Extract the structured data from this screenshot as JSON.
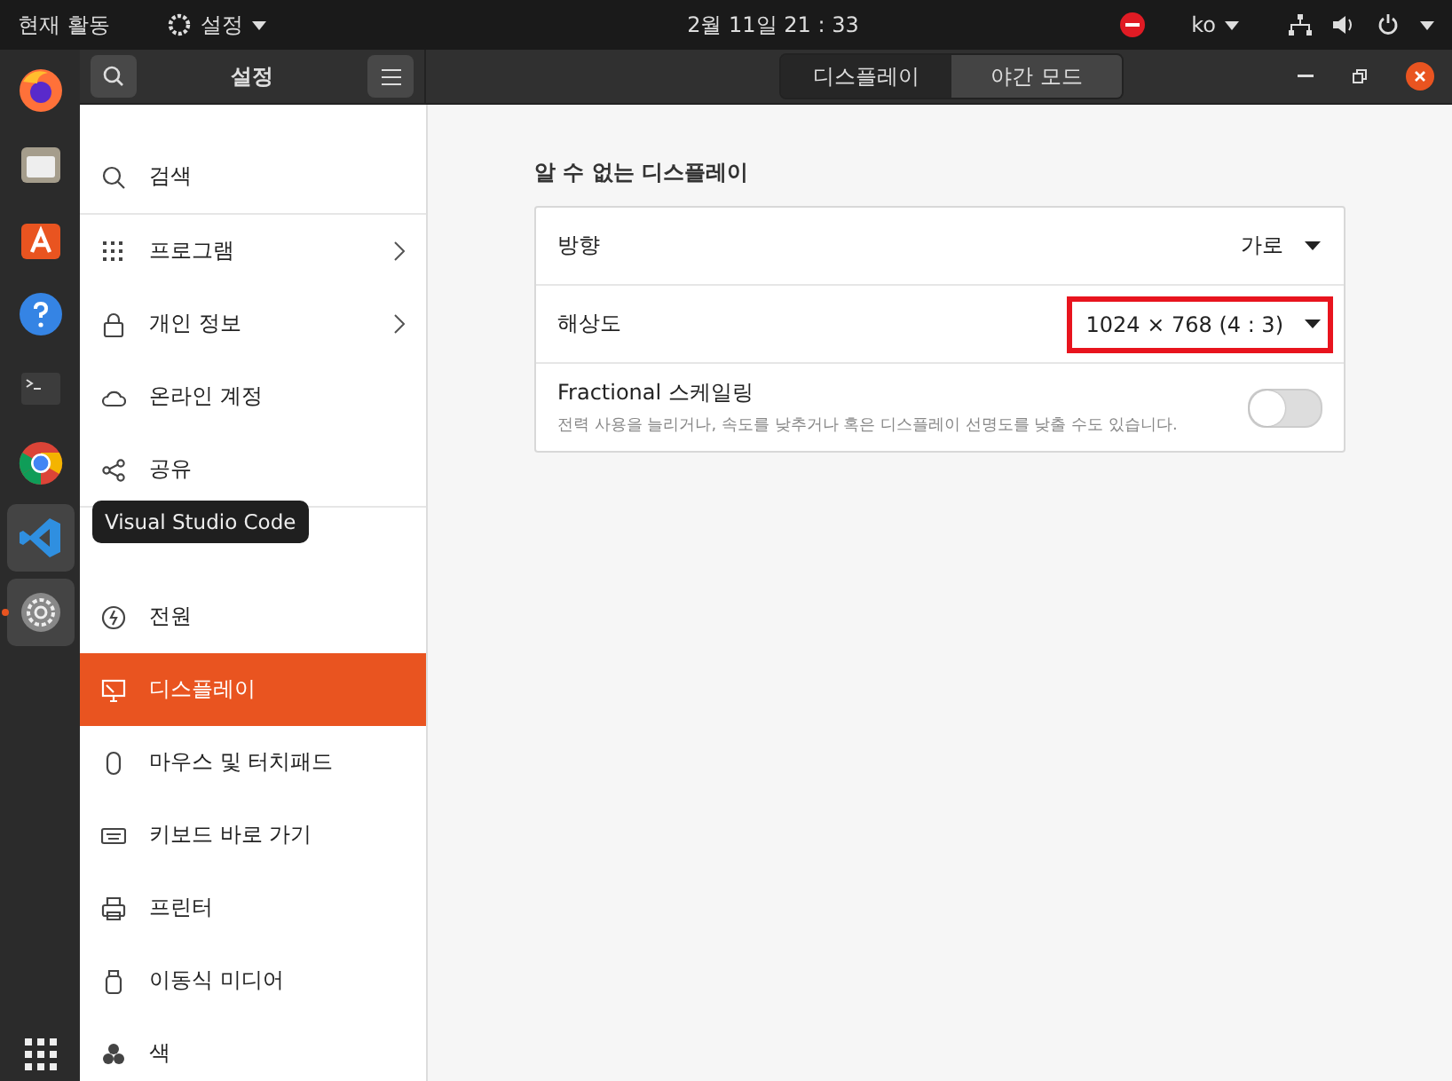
{
  "top_bar": {
    "activities": "현재 활동",
    "app_menu": "설정",
    "clock": "2월 11일  21 : 33",
    "language": "ko"
  },
  "dock": [
    {
      "kind": "firefox",
      "highlighted": false
    },
    {
      "kind": "files",
      "highlighted": false
    },
    {
      "kind": "store",
      "highlighted": false
    },
    {
      "kind": "help",
      "highlighted": false
    },
    {
      "kind": "terminal",
      "highlighted": false
    },
    {
      "kind": "chrome",
      "highlighted": false
    },
    {
      "kind": "vscode",
      "highlighted": true
    },
    {
      "kind": "settings",
      "highlighted": true,
      "running": true
    }
  ],
  "tooltip": "Visual Studio Code",
  "header": {
    "title": "설정",
    "tabs": [
      {
        "label": "디스플레이",
        "selected": true
      },
      {
        "label": "야간 모드",
        "selected": false
      }
    ]
  },
  "sidebar": {
    "items": [
      {
        "kind": "search",
        "label": "검색",
        "selected": false,
        "arrow": false,
        "divider": true
      },
      {
        "kind": "apps",
        "label": "프로그램",
        "selected": false,
        "arrow": true,
        "divider": false
      },
      {
        "kind": "lock",
        "label": "개인 정보",
        "selected": false,
        "arrow": true,
        "divider": false
      },
      {
        "kind": "cloud",
        "label": "온라인 계정",
        "selected": false,
        "arrow": false,
        "divider": false
      },
      {
        "kind": "share",
        "label": "공유",
        "selected": false,
        "arrow": false,
        "divider": true
      },
      {
        "selected": false,
        "arrow": false,
        "divider": false
      },
      {
        "kind": "power",
        "label": "전원",
        "selected": false,
        "arrow": false,
        "divider": false
      },
      {
        "kind": "display",
        "label": "디스플레이",
        "selected": true,
        "arrow": false,
        "divider": false
      },
      {
        "kind": "mouse",
        "label": "마우스 및 터치패드",
        "selected": false,
        "arrow": false,
        "divider": false
      },
      {
        "kind": "keyboard",
        "label": "키보드 바로 가기",
        "selected": false,
        "arrow": false,
        "divider": false
      },
      {
        "kind": "printer",
        "label": "프린터",
        "selected": false,
        "arrow": false,
        "divider": false
      },
      {
        "kind": "usb",
        "label": "이동식 미디어",
        "selected": false,
        "arrow": false,
        "divider": false
      },
      {
        "kind": "color",
        "label": "색",
        "selected": false,
        "arrow": false,
        "divider": false
      }
    ]
  },
  "content": {
    "section_title": "알 수 없는 디스플레이",
    "rows": [
      {
        "kind": "dropdown",
        "label": "방향",
        "value": "가로",
        "highlighted": false
      },
      {
        "kind": "dropdown",
        "label": "해상도",
        "value": "1024 × 768 (4 : 3)",
        "highlighted": true
      },
      {
        "kind": "toggle",
        "label": "Fractional 스케일링",
        "description": "전력 사용을 늘리거나, 속도를 낮추거나 혹은 디스플레이 선명도를 낮출 수도 있습니다.",
        "on": false
      }
    ]
  }
}
